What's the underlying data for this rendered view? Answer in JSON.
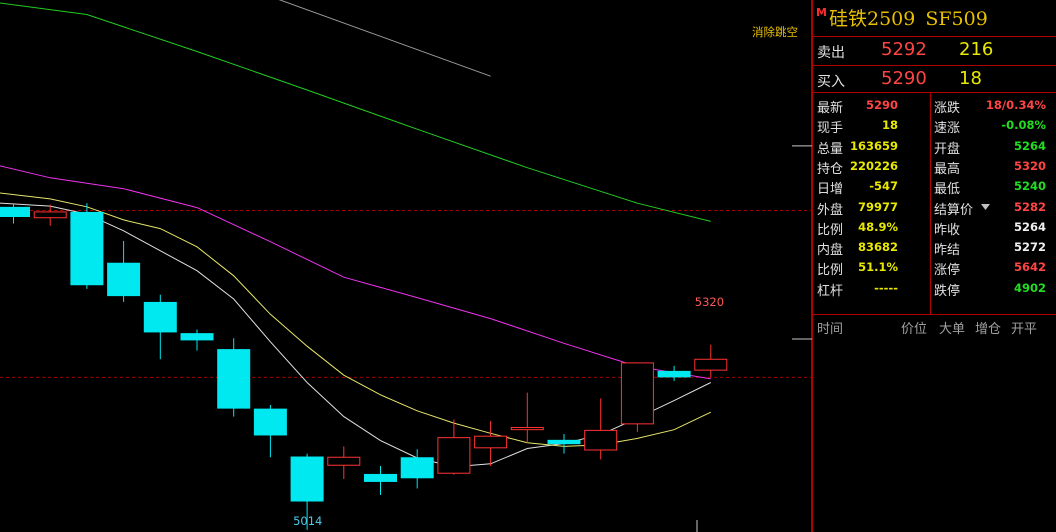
{
  "chart_data": {
    "type": "candlestick",
    "title": "",
    "ylim": [
      4990,
      5560
    ],
    "candles": [
      {
        "open": 5295,
        "close": 5281,
        "high": 5300,
        "low": 5272
      },
      {
        "open": 5280,
        "close": 5288,
        "high": 5298,
        "low": 5269
      },
      {
        "open": 5288,
        "close": 5187,
        "high": 5300,
        "low": 5182
      },
      {
        "open": 5218,
        "close": 5172,
        "high": 5248,
        "low": 5164
      },
      {
        "open": 5164,
        "close": 5122,
        "high": 5174,
        "low": 5085
      },
      {
        "open": 5121,
        "close": 5111,
        "high": 5126,
        "low": 5097
      },
      {
        "open": 5099,
        "close": 5017,
        "high": 5114,
        "low": 5006
      },
      {
        "open": 5017,
        "close": 4980,
        "high": 5022,
        "low": 4950
      },
      {
        "open": 4951,
        "close": 4889,
        "high": 4955,
        "low": 4850
      },
      {
        "open": 4939,
        "close": 4950,
        "high": 4965,
        "low": 4920
      },
      {
        "open": 4927,
        "close": 4916,
        "high": 4938,
        "low": 4898
      },
      {
        "open": 4950,
        "close": 4921,
        "high": 4961,
        "low": 4907
      },
      {
        "open": 4928,
        "close": 4977,
        "high": 5002,
        "low": 4926
      },
      {
        "open": 4963,
        "close": 4979,
        "high": 5000,
        "low": 4938
      },
      {
        "open": 4988,
        "close": 4991,
        "high": 5039,
        "low": 4969
      },
      {
        "open": 4974,
        "close": 4968,
        "high": 4982,
        "low": 4955
      },
      {
        "open": 4960,
        "close": 4987,
        "high": 5031,
        "low": 4947
      },
      {
        "open": 4996,
        "close": 5080,
        "high": 5080,
        "low": 4985
      },
      {
        "open": 5069,
        "close": 5060,
        "high": 5076,
        "low": 5055
      },
      {
        "open": 5070,
        "close": 5085,
        "high": 5105,
        "low": 5060
      }
    ],
    "ma_lines": [
      {
        "color": "#9a9a9a",
        "points": [
          [
            1.8,
            5680
          ],
          [
            13,
            5475
          ]
        ]
      },
      {
        "color": "#22cc22",
        "points": [
          [
            -1,
            5580
          ],
          [
            2,
            5560
          ],
          [
            5,
            5509
          ],
          [
            8,
            5456
          ],
          [
            11,
            5402
          ],
          [
            14,
            5349
          ],
          [
            17,
            5300
          ],
          [
            19,
            5275
          ]
        ]
      },
      {
        "color": "#ee33ee",
        "points": [
          [
            -1,
            5359
          ],
          [
            1,
            5335
          ],
          [
            3,
            5320
          ],
          [
            5,
            5294
          ],
          [
            7,
            5247
          ],
          [
            9,
            5198
          ],
          [
            11,
            5170
          ],
          [
            13,
            5141
          ],
          [
            15,
            5107
          ],
          [
            17,
            5075
          ],
          [
            19,
            5058
          ]
        ]
      },
      {
        "color": "#e0e0e0",
        "points": [
          [
            -1,
            5302
          ],
          [
            1,
            5296
          ],
          [
            2,
            5285
          ],
          [
            3,
            5262
          ],
          [
            5,
            5207
          ],
          [
            6,
            5168
          ],
          [
            7,
            5109
          ],
          [
            8,
            5053
          ],
          [
            9,
            5006
          ],
          [
            10,
            4973
          ],
          [
            11,
            4949
          ],
          [
            12,
            4937
          ],
          [
            13,
            4941
          ],
          [
            14,
            4962
          ],
          [
            15,
            4969
          ],
          [
            16,
            4981
          ],
          [
            17,
            5004
          ],
          [
            18,
            5028
          ],
          [
            19,
            5053
          ]
        ]
      },
      {
        "color": "#e6e66a",
        "points": [
          [
            -1,
            5318
          ],
          [
            1,
            5306
          ],
          [
            2,
            5295
          ],
          [
            3,
            5277
          ],
          [
            4,
            5265
          ],
          [
            5,
            5240
          ],
          [
            6,
            5200
          ],
          [
            7,
            5147
          ],
          [
            8,
            5103
          ],
          [
            9,
            5063
          ],
          [
            10,
            5036
          ],
          [
            11,
            5014
          ],
          [
            12,
            4997
          ],
          [
            13,
            4983
          ],
          [
            14,
            4970
          ],
          [
            15,
            4965
          ],
          [
            16,
            4967
          ],
          [
            17,
            4976
          ],
          [
            18,
            4988
          ],
          [
            19,
            5012
          ]
        ]
      }
    ],
    "ref_lines": [
      5290,
      5060
    ],
    "annotations": {
      "high_label": "5320",
      "low_label": "5014"
    },
    "gap_label": "消除跳空"
  },
  "panel": {
    "badge": "M",
    "title_name": "硅铁2509",
    "title_code": "SF509",
    "ask": {
      "label": "卖出",
      "price": "5292",
      "volume": "216"
    },
    "bid": {
      "label": "买入",
      "price": "5290",
      "volume": "18"
    },
    "stats": [
      {
        "k1": "最新",
        "v1": "5290",
        "c1": "red",
        "k2": "涨跌",
        "v2": "18/0.34%",
        "c2": "red"
      },
      {
        "k1": "现手",
        "v1": "18",
        "c1": "yellow",
        "k2": "速涨",
        "v2": "-0.08%",
        "c2": "green"
      },
      {
        "k1": "总量",
        "v1": "163659",
        "c1": "yellow",
        "k2": "开盘",
        "v2": "5264",
        "c2": "green"
      },
      {
        "k1": "持仓",
        "v1": "220226",
        "c1": "yellow",
        "k2": "最高",
        "v2": "5320",
        "c2": "red"
      },
      {
        "k1": "日增",
        "v1": "-547",
        "c1": "yellow",
        "k2": "最低",
        "v2": "5240",
        "c2": "green"
      },
      {
        "k1": "外盘",
        "v1": "79977",
        "c1": "yellow",
        "k2": "结算价",
        "v2": "5282",
        "c2": "red"
      },
      {
        "k1": "比例",
        "v1": "48.9%",
        "c1": "yellow",
        "k2": "昨收",
        "v2": "5264",
        "c2": "white"
      },
      {
        "k1": "内盘",
        "v1": "83682",
        "c1": "yellow",
        "k2": "昨结",
        "v2": "5272",
        "c2": "white"
      },
      {
        "k1": "比例",
        "v1": "51.1%",
        "c1": "yellow",
        "k2": "涨停",
        "v2": "5642",
        "c2": "red"
      },
      {
        "k1": "杠杆",
        "v1": "-----",
        "c1": "yellow",
        "k2": "跌停",
        "v2": "4902",
        "c2": "green"
      }
    ],
    "tick_headers": [
      "时间",
      "价位",
      "大单",
      "增仓",
      "开平"
    ],
    "colors": {
      "up": "#ff3333",
      "down": "#00e8f0",
      "grid_red": "#b00000"
    }
  }
}
